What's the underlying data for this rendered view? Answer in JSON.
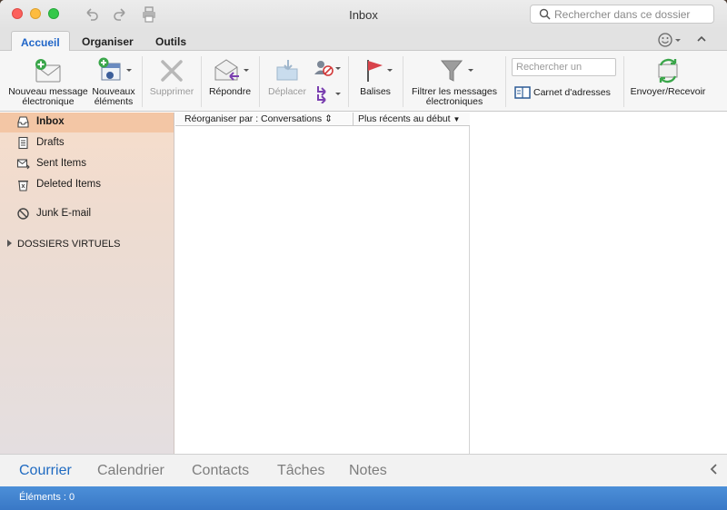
{
  "window": {
    "title": "Inbox"
  },
  "search": {
    "placeholder": "Rechercher dans ce dossier"
  },
  "tabs": [
    {
      "label": "Accueil",
      "active": true
    },
    {
      "label": "Organiser"
    },
    {
      "label": "Outils"
    }
  ],
  "ribbon": {
    "new_message": [
      "Nouveau message",
      "électronique"
    ],
    "new_items": [
      "Nouveaux",
      "éléments"
    ],
    "delete": "Supprimer",
    "reply": "Répondre",
    "move": "Déplacer",
    "flags": "Balises",
    "filter": [
      "Filtrer les messages",
      "électroniques"
    ],
    "search_placeholder": "Rechercher un",
    "address_book": "Carnet d'adresses",
    "send_receive": "Envoyer/Recevoir"
  },
  "folders": [
    {
      "label": "Inbox",
      "icon": "inbox-icon",
      "selected": true
    },
    {
      "label": "Drafts",
      "icon": "drafts-icon"
    },
    {
      "label": "Sent Items",
      "icon": "sent-icon"
    },
    {
      "label": "Deleted Items",
      "icon": "trash-icon"
    },
    {
      "label": "Junk E-mail",
      "icon": "junk-icon"
    }
  ],
  "virtual_folders": "DOSSIERS VIRTUELS",
  "message_list": {
    "sort_by": "Réorganiser par : Conversations",
    "order": "Plus récents au début"
  },
  "nav": [
    {
      "label": "Courrier",
      "active": true
    },
    {
      "label": "Calendrier"
    },
    {
      "label": "Contacts"
    },
    {
      "label": "Tâches"
    },
    {
      "label": "Notes"
    }
  ],
  "status": "Éléments : 0",
  "colors": {
    "accent": "#1f6ac1",
    "selection": "#f3c6a5",
    "statusbar": "#3978c6"
  }
}
